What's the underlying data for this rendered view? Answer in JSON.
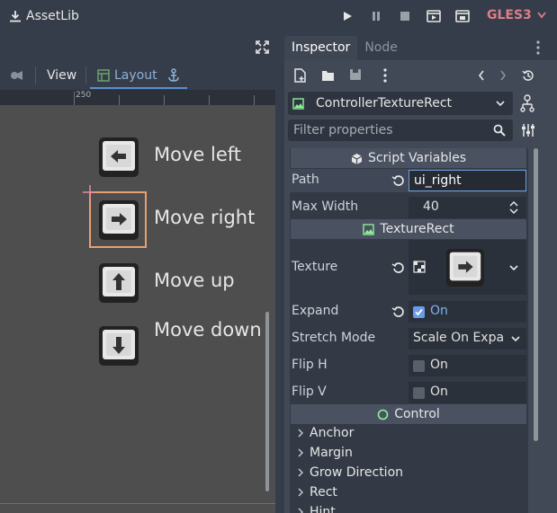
{
  "topbar": {
    "assetlib_label": "AssetLib",
    "renderer": "GLES3"
  },
  "viewport": {
    "toolbar": {
      "view_label": "View",
      "layout_label": "Layout"
    },
    "ruler_label": "250",
    "items": [
      {
        "label": "Move left",
        "key": "left"
      },
      {
        "label": "Move right",
        "key": "right"
      },
      {
        "label": "Move up",
        "key": "up"
      },
      {
        "label": "Move down",
        "key": "down"
      }
    ]
  },
  "inspector": {
    "tabs": {
      "inspector": "Inspector",
      "node": "Node"
    },
    "node_name": "ControllerTextureRect",
    "filter_placeholder": "Filter properties",
    "sections": {
      "script_variables": "Script Variables",
      "texture_rect": "TextureRect",
      "control": "Control"
    },
    "props": {
      "path_label": "Path",
      "path_value": "ui_right",
      "max_width_label": "Max Width",
      "max_width_value": "40",
      "texture_label": "Texture",
      "expand_label": "Expand",
      "expand_value": "On",
      "stretch_label": "Stretch Mode",
      "stretch_value": "Scale On Expa",
      "fliph_label": "Flip H",
      "fliph_value": "On",
      "flipv_label": "Flip V",
      "flipv_value": "On"
    },
    "control_groups": [
      "Anchor",
      "Margin",
      "Grow Direction",
      "Rect",
      "Hint"
    ]
  },
  "colors": {
    "accent": "#e8a072",
    "renderer": "#df7d86",
    "checked": "#699ce8"
  }
}
